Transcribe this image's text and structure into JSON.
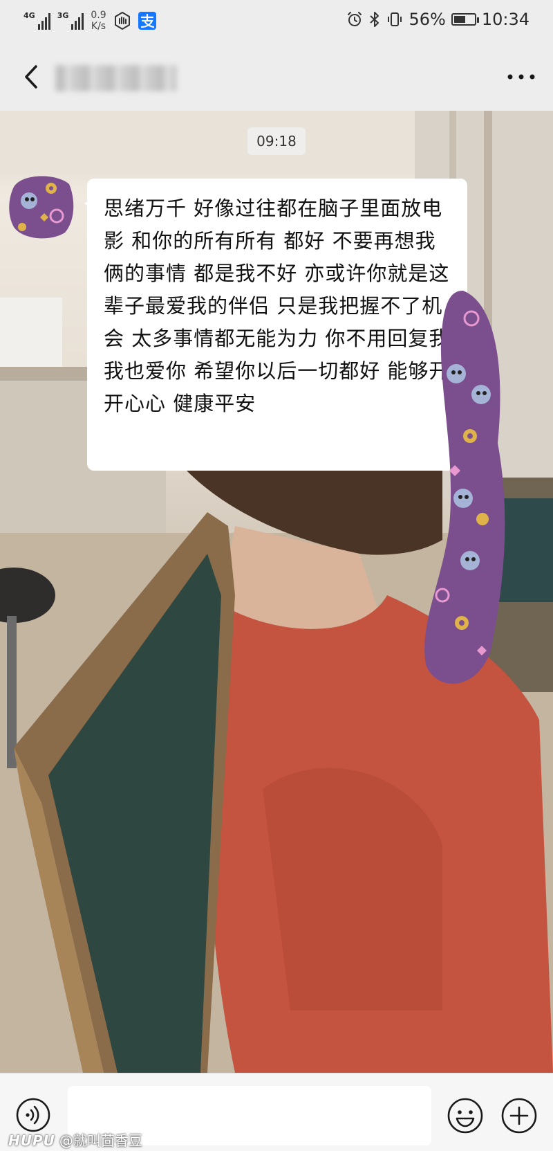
{
  "status_bar": {
    "signal_1_tag": "4G",
    "signal_2_tag": "3G",
    "net_speed_value": "0.9",
    "net_speed_unit": "K/s",
    "battery_percent": "56%",
    "battery_level": 0.56,
    "time": "10:34",
    "icons": [
      "signal-icon",
      "hand-icon",
      "alipay-icon",
      "alarm-icon",
      "bluetooth-icon",
      "vibrate-icon",
      "battery-icon"
    ]
  },
  "header": {
    "back_icon": "chevron-left-icon",
    "more_icon": "more-dots-icon"
  },
  "chat": {
    "timestamp": "09:18",
    "messages": [
      {
        "sender": "other",
        "text": "思绪万千 好像过往都在脑子里面放电影 和你的所有所有 都好 不要再想我俩的事情 都是我不好 亦或许你就是这辈子最爱我的伴侣 只是我把握不了机会 太多事情都无能为力 你不用回复我 我也爱你 希望你以后一切都好 能够开开心心 健康平安"
      }
    ]
  },
  "input_bar": {
    "voice_icon": "voice-icon",
    "emoji_icon": "emoji-icon",
    "plus_icon": "plus-icon",
    "input_value": ""
  },
  "watermark": {
    "brand": "HUPU",
    "handle": "@就叫茴香豆"
  },
  "colors": {
    "background": "#ededed",
    "bubble": "#ffffff",
    "sticker_purple": "#7b4f8e",
    "shirt": "#c4533f"
  }
}
